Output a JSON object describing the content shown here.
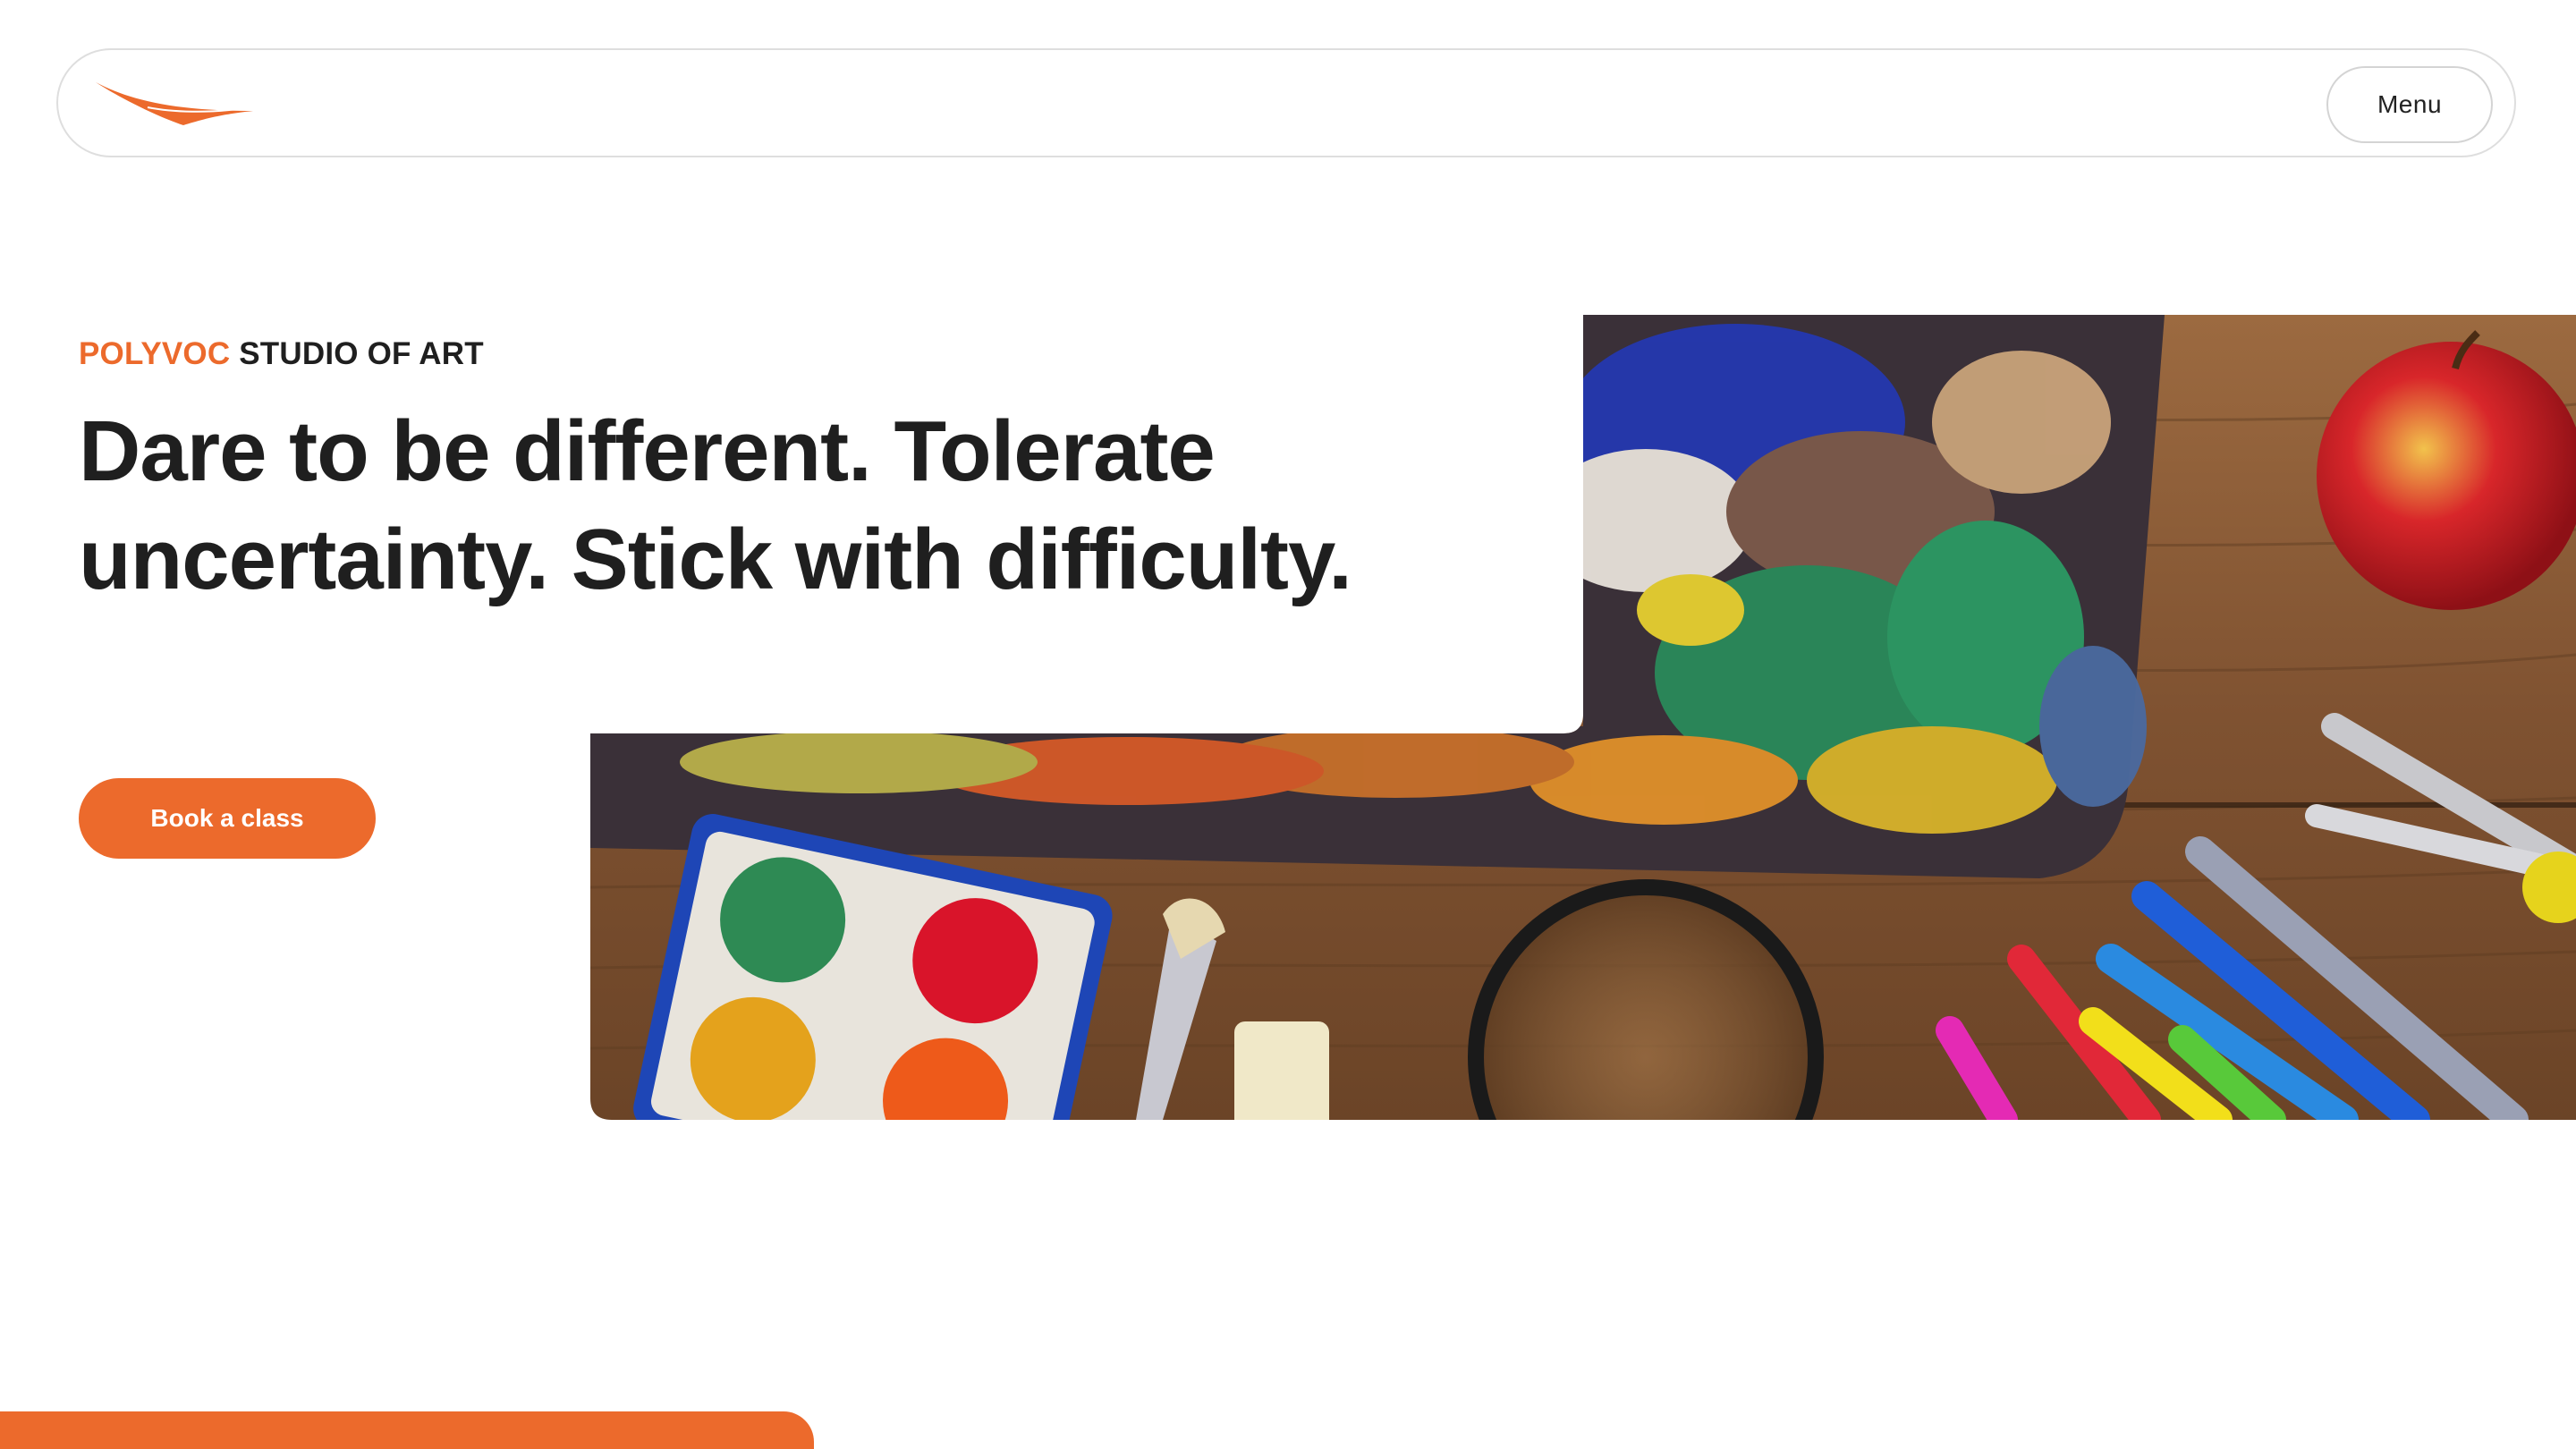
{
  "header": {
    "logo_icon": "swoosh-logo-icon",
    "menu_label": "Menu"
  },
  "hero": {
    "eyebrow_brand": "POLYVOC",
    "eyebrow_rest": "STUDIO OF ART",
    "headline": "Dare to be different. Tolerate uncertainty. Stick with difficulty.",
    "cta_label": "Book a class",
    "image_icon": "art-supplies-photo"
  },
  "colors": {
    "accent": "#ec6a2c",
    "text": "#1f1f1f",
    "wood": "#8a5a34"
  }
}
